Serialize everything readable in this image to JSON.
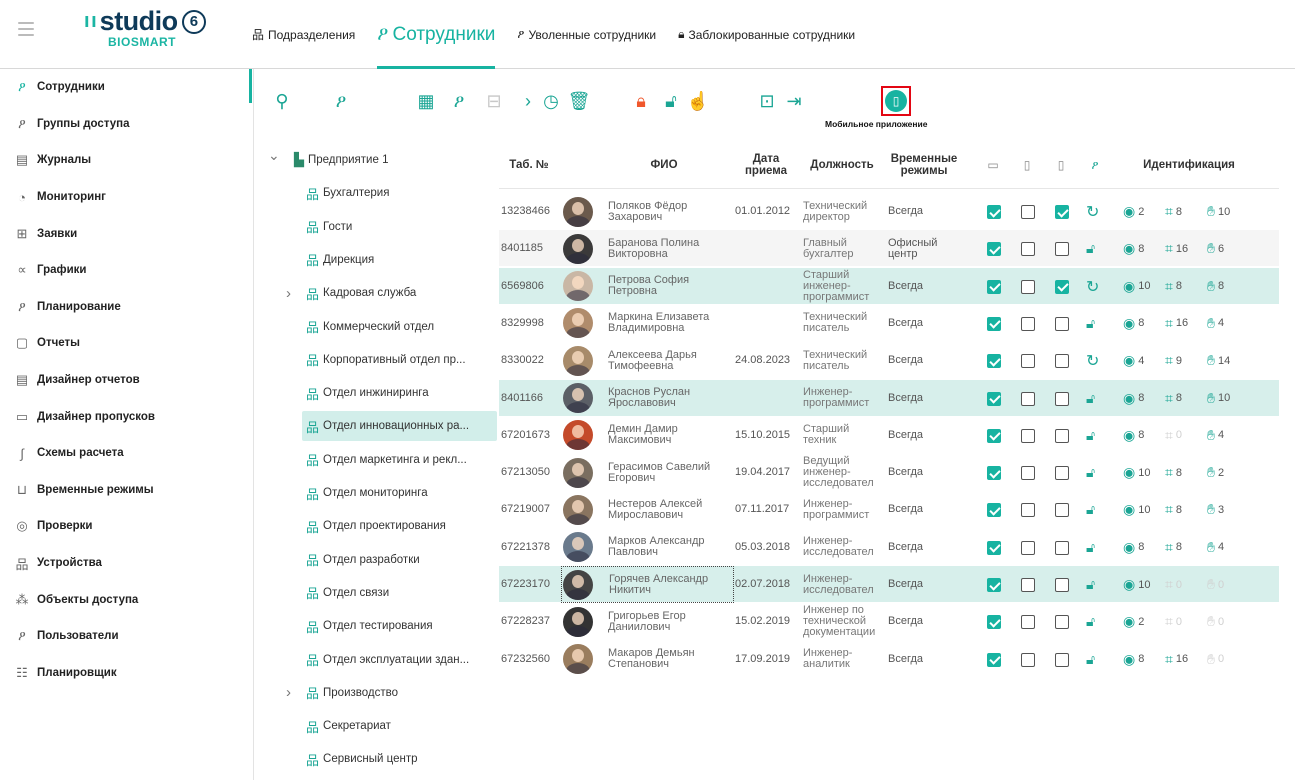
{
  "app": {
    "logo_text": "studio",
    "logo_six": "6",
    "logo_sub": "BIOSMART",
    "colors": {
      "accent": "#17b3a1",
      "brand_dark": "#0e3a59",
      "orange": "#f0572c",
      "highlight_row": "#d7efeb",
      "mobile_frame": "#e30613"
    }
  },
  "nav": [
    {
      "icon": "org-chart-icon",
      "glyph": "品",
      "label": "Подразделения",
      "active": false
    },
    {
      "icon": "person-icon",
      "glyph": "ዖ",
      "label": "Сотрудники",
      "active": true
    },
    {
      "icon": "person-fired-icon",
      "glyph": "ዖ",
      "label": "Уволенные сотрудники",
      "active": false
    },
    {
      "icon": "lock-icon",
      "glyph": "🔒︎",
      "label": "Заблокированные сотрудники",
      "active": false
    }
  ],
  "sidebar": [
    {
      "icon": "person-icon",
      "glyph": "ዖ",
      "label": "Сотрудники",
      "active": true
    },
    {
      "icon": "access-group-icon",
      "glyph": "ዖ",
      "label": "Группы доступа"
    },
    {
      "icon": "journal-icon",
      "glyph": "▤",
      "label": "Журналы"
    },
    {
      "icon": "monitoring-icon",
      "glyph": "◔",
      "label": "Мониторинг"
    },
    {
      "icon": "request-icon",
      "glyph": "⊞",
      "label": "Заявки"
    },
    {
      "icon": "graph-icon",
      "glyph": "∝",
      "label": "Графики"
    },
    {
      "icon": "planning-icon",
      "glyph": "ዖ",
      "label": "Планирование"
    },
    {
      "icon": "report-icon",
      "glyph": "▢",
      "label": "Отчеты"
    },
    {
      "icon": "report-designer-icon",
      "glyph": "▤",
      "label": "Дизайнер отчетов"
    },
    {
      "icon": "pass-designer-icon",
      "glyph": "▭",
      "label": "Дизайнер пропусков"
    },
    {
      "icon": "calc-scheme-icon",
      "glyph": "∫",
      "label": "Схемы расчета"
    },
    {
      "icon": "time-mode-icon",
      "glyph": "⊔",
      "label": "Временные режимы"
    },
    {
      "icon": "check-icon",
      "glyph": "◎",
      "label": "Проверки"
    },
    {
      "icon": "device-icon",
      "glyph": "品",
      "label": "Устройства"
    },
    {
      "icon": "access-object-icon",
      "glyph": "⁂",
      "label": "Объекты доступа"
    },
    {
      "icon": "user-icon",
      "glyph": "ዖ",
      "label": "Пользователи"
    },
    {
      "icon": "scheduler-icon",
      "glyph": "☷",
      "label": "Планировщик"
    }
  ],
  "toolbar": {
    "buttons": [
      {
        "name": "search-icon",
        "glyph": "⚲",
        "color": "teal"
      },
      {
        "name": "add-person-icon",
        "glyph": "ዖ",
        "color": "teal"
      },
      {
        "name": "card-check-icon",
        "glyph": "▦",
        "color": "teal"
      },
      {
        "name": "add-group-icon",
        "glyph": "ዖ",
        "color": "teal"
      },
      {
        "name": "move-icon",
        "glyph": "⊟",
        "color": "grey"
      },
      {
        "name": "chevron-right-icon",
        "glyph": "›",
        "color": "teal"
      },
      {
        "name": "history-icon",
        "glyph": "◷",
        "color": "teal"
      },
      {
        "name": "trash-icon",
        "glyph": "🗑︎",
        "color": "teal"
      },
      {
        "name": "lock-icon",
        "glyph": "🔒︎",
        "color": "orange"
      },
      {
        "name": "unlock-icon",
        "glyph": "🔓︎",
        "color": "teal"
      },
      {
        "name": "fingerprint-settings-icon",
        "glyph": "☝",
        "color": "teal"
      },
      {
        "name": "export-icon",
        "glyph": "⊡",
        "color": "teal"
      },
      {
        "name": "import-icon",
        "glyph": "⇥",
        "color": "teal"
      },
      {
        "name": "mobile-app-icon",
        "glyph": "▯",
        "color": "mobile"
      }
    ],
    "tooltip": "Мобильное приложение"
  },
  "tree": [
    {
      "label": "Предприятие 1",
      "level": 0,
      "arrow": "⌄",
      "root": true
    },
    {
      "label": "Бухгалтерия",
      "level": 1
    },
    {
      "label": "Гости",
      "level": 1
    },
    {
      "label": "Дирекция",
      "level": 1
    },
    {
      "label": "Кадровая служба",
      "level": 1,
      "arrow": "›"
    },
    {
      "label": "Коммерческий отдел",
      "level": 1
    },
    {
      "label": "Корпоративный отдел пр...",
      "level": 1
    },
    {
      "label": "Отдел инжиниринга",
      "level": 1
    },
    {
      "label": "Отдел инновационных ра...",
      "level": 1,
      "selected": true
    },
    {
      "label": "Отдел маркетинга и рекл...",
      "level": 1
    },
    {
      "label": "Отдел мониторинга",
      "level": 1
    },
    {
      "label": "Отдел проектирования",
      "level": 1
    },
    {
      "label": "Отдел разработки",
      "level": 1
    },
    {
      "label": "Отдел связи",
      "level": 1
    },
    {
      "label": "Отдел тестирования",
      "level": 1
    },
    {
      "label": "Отдел эксплуатации здан...",
      "level": 1
    },
    {
      "label": "Производство",
      "level": 1,
      "arrow": "›"
    },
    {
      "label": "Секретариат",
      "level": 1
    },
    {
      "label": "Сервисный центр",
      "level": 1
    }
  ],
  "table": {
    "headers": {
      "tab": "Таб. №",
      "fio": "ФИО",
      "date": "Дата приема",
      "pos": "Должность",
      "mode": "Временные режимы",
      "ident": "Идентификация"
    },
    "rows": [
      {
        "tab": "13238466",
        "fio": "Поляков Фёдор Захарович",
        "date": "01.01.2012",
        "pos": "Технический директор",
        "mode": "Всегда",
        "cb": [
          true,
          false,
          true
        ],
        "status": "sync",
        "fp": "2",
        "face": "8",
        "palm": "10",
        "style": ""
      },
      {
        "tab": "8401185",
        "fio": "Баранова Полина Викторовна",
        "date": "",
        "pos": "Главный бухгалтер",
        "mode": "Офисный центр",
        "cb": [
          true,
          false,
          false
        ],
        "status": "unlock",
        "fp": "8",
        "face": "16",
        "palm": "6",
        "style": "alt"
      },
      {
        "tab": "6569806",
        "fio": "Петрова София Петровна",
        "date": "",
        "pos": "Старший инженер-программист",
        "mode": "Всегда",
        "cb": [
          true,
          false,
          true
        ],
        "status": "sync",
        "fp": "10",
        "face": "8",
        "palm": "8",
        "style": "hl"
      },
      {
        "tab": "8329998",
        "fio": "Маркина Елизавета Владимировна",
        "date": "",
        "pos": "Технический писатель",
        "mode": "Всегда",
        "cb": [
          true,
          false,
          false
        ],
        "status": "unlock",
        "fp": "8",
        "face": "16",
        "palm": "4",
        "style": ""
      },
      {
        "tab": "8330022",
        "fio": "Алексеева Дарья Тимофеевна",
        "date": "24.08.2023",
        "pos": "Технический писатель",
        "mode": "Всегда",
        "cb": [
          true,
          false,
          false
        ],
        "status": "sync",
        "fp": "4",
        "face": "9",
        "palm": "14",
        "style": ""
      },
      {
        "tab": "8401166",
        "fio": "Краснов Руслан Ярославович",
        "date": "",
        "pos": "Инженер-программист",
        "mode": "Всегда",
        "cb": [
          true,
          false,
          false
        ],
        "status": "unlock",
        "fp": "8",
        "face": "8",
        "palm": "10",
        "style": "hl"
      },
      {
        "tab": "67201673",
        "fio": "Демин Дамир Максимович",
        "date": "15.10.2015",
        "pos": "Старший техник",
        "mode": "Всегда",
        "cb": [
          true,
          false,
          false
        ],
        "status": "unlock",
        "fp": "8",
        "face": "0",
        "palm": "4",
        "style": "",
        "faceFaded": true
      },
      {
        "tab": "67213050",
        "fio": "Герасимов Савелий Егорович",
        "date": "19.04.2017",
        "pos": "Ведущий инженер-исследовател",
        "mode": "Всегда",
        "cb": [
          true,
          false,
          false
        ],
        "status": "unlock",
        "fp": "10",
        "face": "8",
        "palm": "2",
        "style": ""
      },
      {
        "tab": "67219007",
        "fio": "Нестеров Алексей Мирославович",
        "date": "07.11.2017",
        "pos": "Инженер-программист",
        "mode": "Всегда",
        "cb": [
          true,
          false,
          false
        ],
        "status": "unlock",
        "fp": "10",
        "face": "8",
        "palm": "3",
        "style": ""
      },
      {
        "tab": "67221378",
        "fio": "Марков Александр Павлович",
        "date": "05.03.2018",
        "pos": "Инженер-исследовател",
        "mode": "Всегда",
        "cb": [
          true,
          false,
          false
        ],
        "status": "unlock",
        "fp": "8",
        "face": "8",
        "palm": "4",
        "style": ""
      },
      {
        "tab": "67223170",
        "fio": "Горячев Александр Никитич",
        "date": "02.07.2018",
        "pos": "Инженер-исследовател",
        "mode": "Всегда",
        "cb": [
          true,
          false,
          false
        ],
        "status": "unlock",
        "fp": "10",
        "face": "0",
        "palm": "0",
        "style": "hl",
        "faceFaded": true,
        "palmFaded": true
      },
      {
        "tab": "67228237",
        "fio": "Григорьев Егор Даниилович",
        "date": "15.02.2019",
        "pos": "Инженер по технической документации",
        "mode": "Всегда",
        "cb": [
          true,
          false,
          false
        ],
        "status": "unlock",
        "fp": "2",
        "face": "0",
        "palm": "0",
        "style": "",
        "faceFaded": true,
        "palmFaded": true
      },
      {
        "tab": "67232560",
        "fio": "Макаров Демьян Степанович",
        "date": "17.09.2019",
        "pos": "Инженер-аналитик",
        "mode": "Всегда",
        "cb": [
          true,
          false,
          false
        ],
        "status": "unlock",
        "fp": "8",
        "face": "16",
        "palm": "0",
        "style": "",
        "palmFaded": true
      }
    ]
  }
}
